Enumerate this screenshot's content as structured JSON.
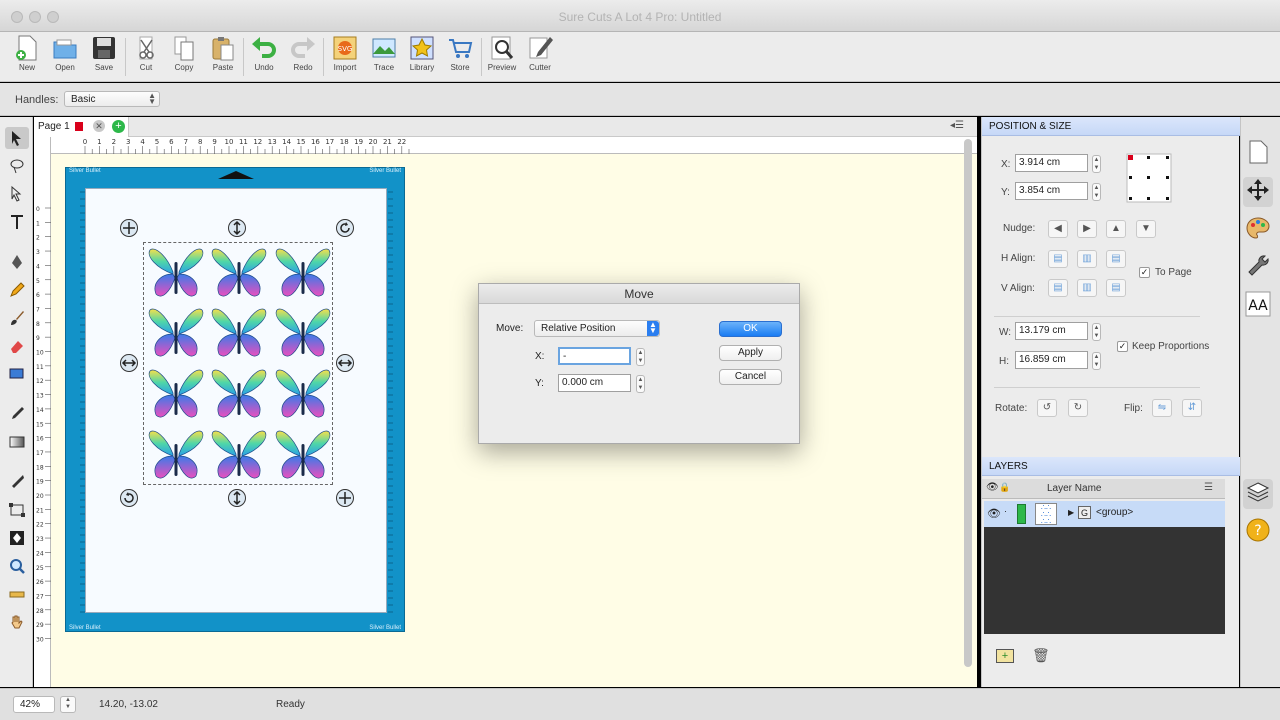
{
  "window": {
    "title": "Sure Cuts A Lot 4 Pro: Untitled"
  },
  "toolbar": {
    "buttons": [
      {
        "label": "New",
        "icon": "new-document-icon"
      },
      {
        "label": "Open",
        "icon": "open-folder-icon"
      },
      {
        "label": "Save",
        "icon": "save-disk-icon"
      },
      {
        "label": "Cut",
        "icon": "scissors-icon"
      },
      {
        "label": "Copy",
        "icon": "copy-icon"
      },
      {
        "label": "Paste",
        "icon": "paste-icon"
      },
      {
        "label": "Undo",
        "icon": "undo-arrow-icon"
      },
      {
        "label": "Redo",
        "icon": "redo-arrow-icon"
      },
      {
        "label": "Import",
        "icon": "import-svg-icon"
      },
      {
        "label": "Trace",
        "icon": "trace-icon"
      },
      {
        "label": "Library",
        "icon": "library-star-icon"
      },
      {
        "label": "Store",
        "icon": "store-cart-icon"
      },
      {
        "label": "Preview",
        "icon": "preview-magnifier-icon"
      },
      {
        "label": "Cutter",
        "icon": "cutter-blade-icon"
      }
    ]
  },
  "options": {
    "handles_label": "Handles:",
    "handles_value": "Basic"
  },
  "workspace": {
    "page_tab": "Page 1",
    "ruler_top_ticks": [
      "0",
      "1",
      "2",
      "3",
      "4",
      "5",
      "6",
      "7",
      "8",
      "9",
      "10",
      "11",
      "12",
      "13",
      "14",
      "15",
      "16",
      "17",
      "18",
      "19",
      "20",
      "21",
      "22"
    ],
    "ruler_left_ticks": [
      "0",
      "1",
      "2",
      "3",
      "4",
      "5",
      "6",
      "7",
      "8",
      "9",
      "10",
      "11",
      "12",
      "13",
      "14",
      "15",
      "16",
      "17",
      "18",
      "19",
      "20",
      "21",
      "22",
      "23",
      "24",
      "25",
      "26",
      "27",
      "28",
      "29",
      "30"
    ],
    "mat_label": "Silver Bullet"
  },
  "dialog": {
    "title": "Move",
    "move_label": "Move:",
    "move_value": "Relative Position",
    "x_label": "X:",
    "x_value": "-",
    "y_label": "Y:",
    "y_value": "0.000 cm",
    "ok": "OK",
    "apply": "Apply",
    "cancel": "Cancel"
  },
  "position_size": {
    "header": "POSITION & SIZE",
    "x_label": "X:",
    "x_value": "3.914 cm",
    "y_label": "Y:",
    "y_value": "3.854 cm",
    "nudge_label": "Nudge:",
    "halign_label": "H Align:",
    "valign_label": "V Align:",
    "to_page_label": "To Page",
    "w_label": "W:",
    "w_value": "13.179 cm",
    "h_label": "H:",
    "h_value": "16.859 cm",
    "keep_proportions_label": "Keep Proportions",
    "rotate_label": "Rotate:",
    "flip_label": "Flip:"
  },
  "layers": {
    "header": "LAYERS",
    "column_name": "Layer Name",
    "row_name": "<group>"
  },
  "status": {
    "zoom": "42%",
    "coords": "14.20, -13.02",
    "state": "Ready"
  },
  "colors": {
    "mat": "#1292c8",
    "accent": "#1a7cf3",
    "panel_header": "#c6d8f7"
  }
}
